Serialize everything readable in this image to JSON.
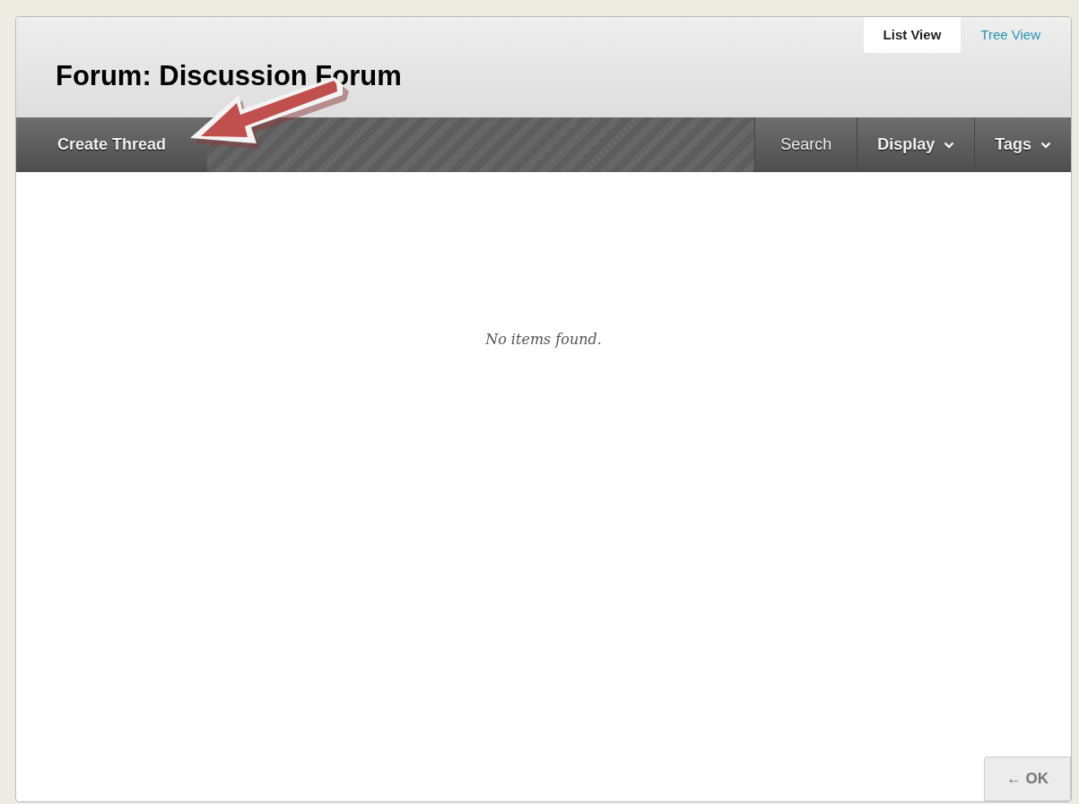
{
  "view_tabs": [
    {
      "label": "List View",
      "selected": true
    },
    {
      "label": "Tree View",
      "selected": false
    }
  ],
  "title": "Forum: Discussion Forum",
  "toolbar": {
    "primary": "Create Thread",
    "actions": [
      {
        "label": "Search",
        "dropdown": false
      },
      {
        "label": "Display",
        "dropdown": true
      },
      {
        "label": "Tags",
        "dropdown": true
      }
    ]
  },
  "empty_message": "No items found.",
  "ok_button": "← OK"
}
